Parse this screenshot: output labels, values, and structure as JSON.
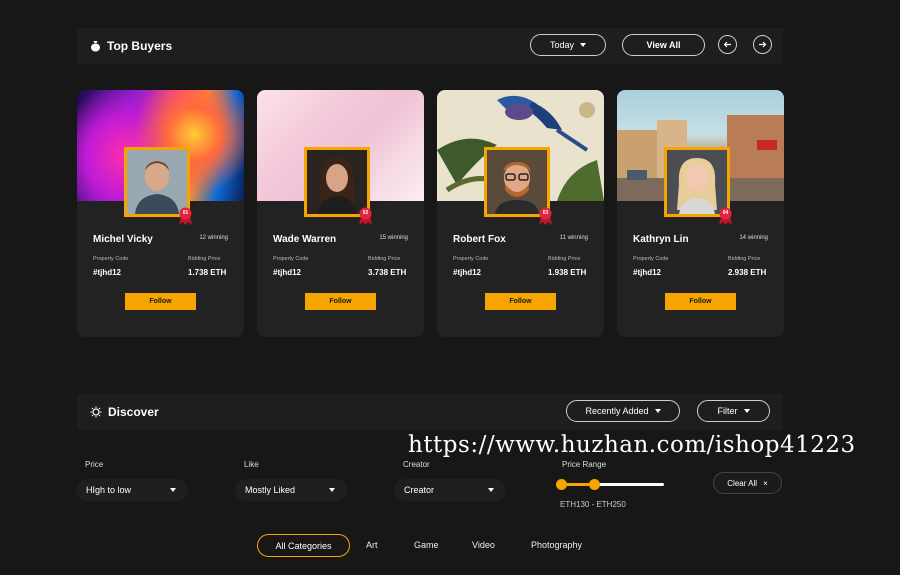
{
  "top_buyers": {
    "title": "Top Buyers",
    "period_select": "Today",
    "view_all": "View All"
  },
  "buyers": [
    {
      "name": "Michel Vicky",
      "winning": "12 winning",
      "rank": "01",
      "code_label": "Property Code",
      "code": "#tjhd12",
      "price_label": "Bidding Price",
      "price": "1.738 ETH",
      "follow": "Follow"
    },
    {
      "name": "Wade Warren",
      "winning": "15 winning",
      "rank": "02",
      "code_label": "Property Code",
      "code": "#tjhd12",
      "price_label": "Bidding Price",
      "price": "3.738 ETH",
      "follow": "Follow"
    },
    {
      "name": "Robert Fox",
      "winning": "11 winning",
      "rank": "03",
      "code_label": "Property Code",
      "code": "#tjhd12",
      "price_label": "Bidding Price",
      "price": "1.938 ETH",
      "follow": "Follow"
    },
    {
      "name": "Kathryn Lin",
      "winning": "14 winning",
      "rank": "04",
      "code_label": "Property Code",
      "code": "#tjhd12",
      "price_label": "Bidding Price",
      "price": "2.938 ETH",
      "follow": "Follow"
    }
  ],
  "discover": {
    "title": "Discover",
    "sort_select": "Recently Added",
    "filter_button": "Filter"
  },
  "filters": {
    "price_label": "Price",
    "price_value": "HIgh to low",
    "like_label": "Like",
    "like_value": "Mostly Liked",
    "creator_label": "Creator",
    "creator_value": "Creator",
    "range_label": "Price Range",
    "range_value": "ETH130 - ETH250",
    "clear_all": "Clear All"
  },
  "categories": [
    "All Categories",
    "Art",
    "Game",
    "Video",
    "Photography"
  ],
  "watermark": "https://www.huzhan.com/ishop41223",
  "colors": {
    "accent": "#f5a400",
    "background": "#171717",
    "card": "#222222"
  }
}
